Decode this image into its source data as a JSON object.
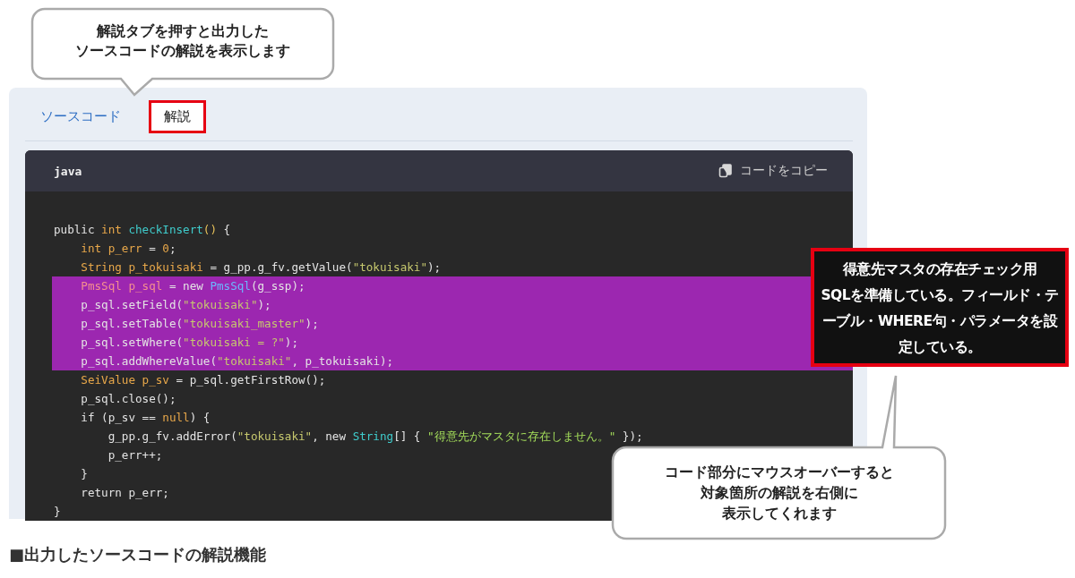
{
  "callouts": [
    {
      "lines": [
        "解説タブを押すと出力した",
        "ソースコードの解説を表示します"
      ],
      "kind": "top"
    },
    {
      "lines": [
        "コード部分にマウスオーバーすると",
        "対象箇所の解説を右側に",
        "表示してくれます"
      ],
      "kind": "bottom"
    }
  ],
  "tabs": [
    {
      "label": "ソースコード",
      "selected": false,
      "annotated": false
    },
    {
      "label": "解説",
      "selected": true,
      "annotated": true
    }
  ],
  "code_block": {
    "language": "java",
    "copy_label": "コードをコピー",
    "lines": [
      {
        "highlighted": false,
        "tokens": [
          {
            "kind": "plain",
            "text": "public "
          },
          {
            "kind": "type",
            "text": "int"
          },
          {
            "kind": "func",
            "text": " checkInsert"
          },
          {
            "kind": "punct",
            "text": "()"
          },
          {
            "kind": "plain",
            "text": " {"
          }
        ]
      },
      {
        "highlighted": false,
        "tokens": [
          {
            "kind": "type",
            "text": "    int p_err"
          },
          {
            "kind": "plain",
            "text": " = "
          },
          {
            "kind": "type",
            "text": "0"
          },
          {
            "kind": "plain",
            "text": ";"
          }
        ]
      },
      {
        "highlighted": false,
        "tokens": [
          {
            "kind": "type",
            "text": "    String p_tokuisaki"
          },
          {
            "kind": "plain",
            "text": " = g_pp.g_fv.getValue("
          },
          {
            "kind": "string",
            "text": "\"tokuisaki\""
          },
          {
            "kind": "plain",
            "text": ");"
          }
        ]
      },
      {
        "highlighted": true,
        "tokens": [
          {
            "kind": "decl",
            "text": "    PmsSql p_sql"
          },
          {
            "kind": "plain",
            "text": " = new "
          },
          {
            "kind": "class",
            "text": "PmsSql"
          },
          {
            "kind": "plain",
            "text": "(g_ssp);"
          }
        ]
      },
      {
        "highlighted": true,
        "tokens": [
          {
            "kind": "plain",
            "text": "    p_sql.setField("
          },
          {
            "kind": "string",
            "text": "\"tokuisaki\""
          },
          {
            "kind": "plain",
            "text": ");"
          }
        ]
      },
      {
        "highlighted": true,
        "tokens": [
          {
            "kind": "plain",
            "text": "    p_sql.setTable("
          },
          {
            "kind": "string",
            "text": "\"tokuisaki_master\""
          },
          {
            "kind": "plain",
            "text": ");"
          }
        ]
      },
      {
        "highlighted": true,
        "tokens": [
          {
            "kind": "plain",
            "text": "    p_sql.setWhere("
          },
          {
            "kind": "string",
            "text": "\"tokuisaki = ?\""
          },
          {
            "kind": "plain",
            "text": ");"
          }
        ]
      },
      {
        "highlighted": true,
        "tokens": [
          {
            "kind": "plain",
            "text": "    p_sql.addWhereValue("
          },
          {
            "kind": "string",
            "text": "\"tokuisaki\""
          },
          {
            "kind": "plain",
            "text": ", p_tokuisaki);"
          }
        ]
      },
      {
        "highlighted": false,
        "tokens": [
          {
            "kind": "type",
            "text": "    SeiValue p_sv"
          },
          {
            "kind": "plain",
            "text": " = p_sql.getFirstRow();"
          }
        ]
      },
      {
        "highlighted": false,
        "tokens": [
          {
            "kind": "plain",
            "text": "    p_sql.close();"
          }
        ]
      },
      {
        "highlighted": false,
        "tokens": [
          {
            "kind": "plain",
            "text": "    if (p_sv == "
          },
          {
            "kind": "type",
            "text": "null"
          },
          {
            "kind": "plain",
            "text": ") {"
          }
        ]
      },
      {
        "highlighted": false,
        "tokens": [
          {
            "kind": "plain",
            "text": "        g_pp.g_fv.addError("
          },
          {
            "kind": "string",
            "text": "\"tokuisaki\""
          },
          {
            "kind": "plain",
            "text": ", new "
          },
          {
            "kind": "func",
            "text": "String"
          },
          {
            "kind": "plain",
            "text": "[] { "
          },
          {
            "kind": "jstring",
            "text": "\"得意先がマスタに存在しません。\""
          },
          {
            "kind": "plain",
            "text": " });"
          }
        ]
      },
      {
        "highlighted": false,
        "tokens": [
          {
            "kind": "plain",
            "text": "        p_err++;"
          }
        ]
      },
      {
        "highlighted": false,
        "tokens": [
          {
            "kind": "plain",
            "text": "    }"
          }
        ]
      },
      {
        "highlighted": false,
        "tokens": [
          {
            "kind": "plain",
            "text": "    return p_err;"
          }
        ]
      },
      {
        "highlighted": false,
        "tokens": [
          {
            "kind": "plain",
            "text": "}"
          }
        ]
      }
    ]
  },
  "tooltip": {
    "lines": [
      "得意先マスタの存在チェック用",
      "SQLを準備している。フィールド・テ",
      "ーブル・WHERE句・パラメータを設",
      "定している。"
    ]
  },
  "caption": "■出力したソースコードの解説機能"
}
